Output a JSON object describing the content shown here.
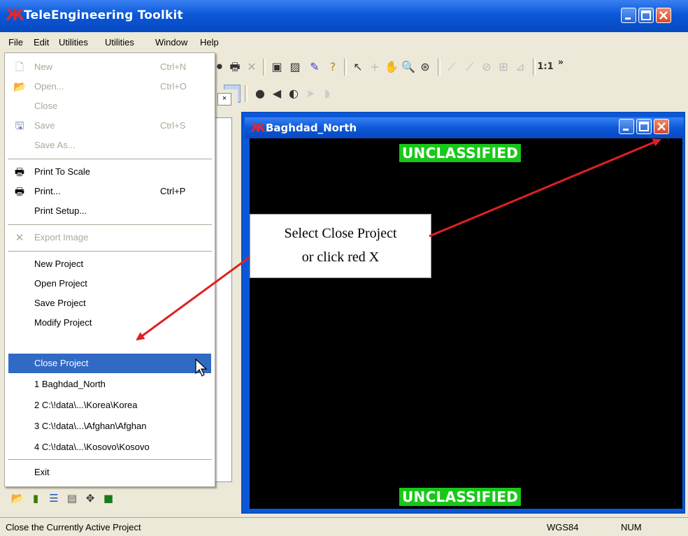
{
  "window": {
    "title": "TeleEngineering Toolkit"
  },
  "menubar": {
    "items": [
      "File",
      "Edit",
      "Utilities",
      "Utilities",
      "Window",
      "Help"
    ]
  },
  "file_menu": {
    "items": [
      {
        "label": "New",
        "shortcut": "Ctrl+N",
        "disabled": true
      },
      {
        "label": "Open...",
        "shortcut": "Ctrl+O",
        "disabled": true
      },
      {
        "label": "Close",
        "shortcut": "",
        "disabled": true
      },
      {
        "label": "Save",
        "shortcut": "Ctrl+S",
        "disabled": true
      },
      {
        "label": "Save As...",
        "shortcut": "",
        "disabled": true
      },
      {
        "label": "Print To Scale",
        "shortcut": ""
      },
      {
        "label": "Print...",
        "shortcut": "Ctrl+P"
      },
      {
        "label": "Print Setup...",
        "shortcut": ""
      },
      {
        "label": "Export Image",
        "shortcut": "",
        "disabled": true
      },
      {
        "label": "New Project",
        "shortcut": ""
      },
      {
        "label": "Open Project",
        "shortcut": ""
      },
      {
        "label": "Save Project",
        "shortcut": ""
      },
      {
        "label": "Modify Project",
        "shortcut": ""
      },
      {
        "label": "Close Project",
        "shortcut": "",
        "highlighted": true
      },
      {
        "label": "1 Baghdad_North",
        "shortcut": ""
      },
      {
        "label": "2 C:\\!data\\...\\Korea\\Korea",
        "shortcut": ""
      },
      {
        "label": "3 C:\\!data\\...\\Afghan\\Afghan",
        "shortcut": ""
      },
      {
        "label": "4 C:\\!data\\...\\Kosovo\\Kosovo",
        "shortcut": ""
      },
      {
        "label": "Exit",
        "shortcut": ""
      }
    ]
  },
  "toolbar": {
    "zoom_label": "1:1",
    "overflow": "»"
  },
  "child_window": {
    "title": "Baghdad_North",
    "banner_top": "UNCLASSIFIED",
    "banner_bottom": "UNCLASSIFIED"
  },
  "callout": {
    "line1": "Select Close Project",
    "line2": "or click red X"
  },
  "statusbar": {
    "message": "Close the Currently Active Project",
    "datum": "WGS84",
    "num": "NUM"
  },
  "colors": {
    "titlebar": "#0a58d8",
    "highlight": "#316ac5",
    "classification": "#18c818",
    "arrow": "#e02020"
  }
}
